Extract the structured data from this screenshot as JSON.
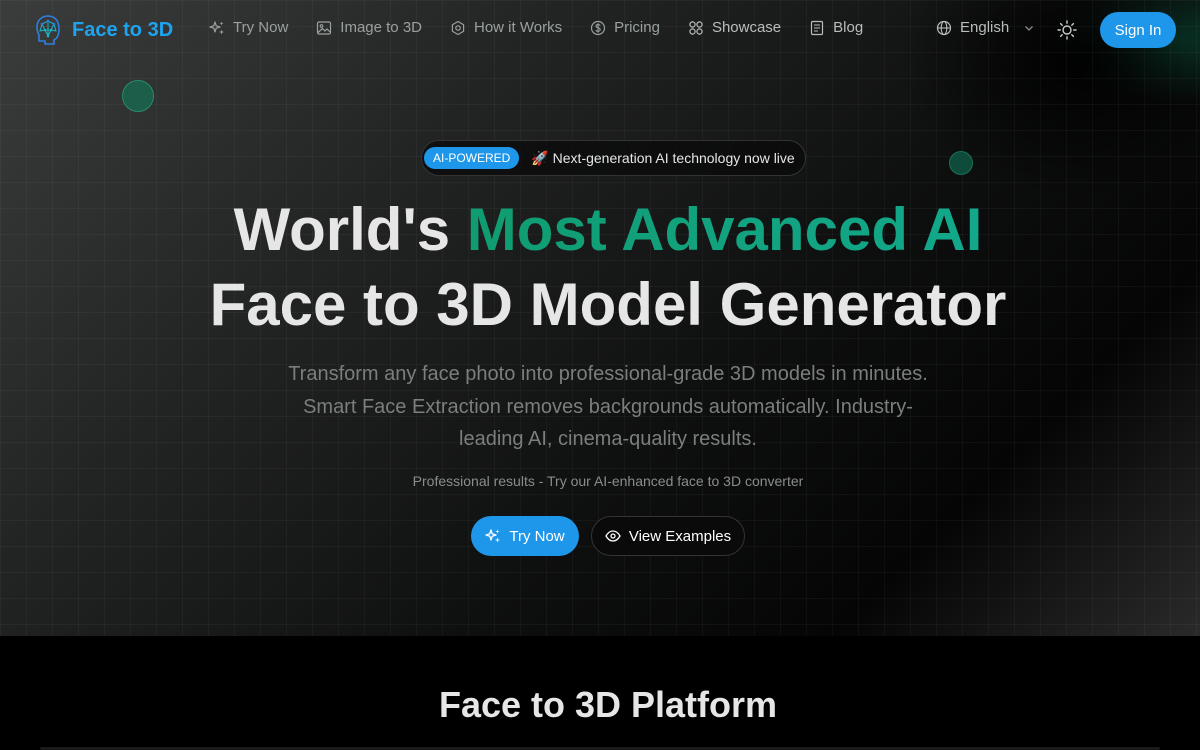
{
  "nav": {
    "brand": "Face to 3D",
    "links": [
      {
        "label": "Try Now",
        "icon": "sparkles-icon"
      },
      {
        "label": "Image to 3D",
        "icon": "image-icon"
      },
      {
        "label": "How it Works",
        "icon": "gear-icon"
      },
      {
        "label": "Pricing",
        "icon": "dollar-circle-icon"
      },
      {
        "label": "Showcase",
        "icon": "grid-icon"
      },
      {
        "label": "Blog",
        "icon": "document-icon"
      }
    ],
    "language": "English",
    "sign_in": "Sign In"
  },
  "hero": {
    "badge_tag": "AI-POWERED",
    "badge_text": "🚀 Next-generation AI technology now live",
    "title_pre": "World's ",
    "title_accent": "Most Advanced AI",
    "title_line2": "Face to 3D Model Generator",
    "subtitle": "Transform any face photo into professional-grade 3D models in minutes. Smart Face Extraction removes backgrounds automatically. Industry-leading AI, cinema-quality results.",
    "note": "Professional results - Try our AI-enhanced face to 3D converter",
    "primary_button": "Try Now",
    "secondary_button": "View Examples"
  },
  "platform": {
    "title": "Face to 3D Platform"
  },
  "colors": {
    "brand_blue": "#1e96ea",
    "accent_green": "#10a37f",
    "background": "#000000"
  }
}
